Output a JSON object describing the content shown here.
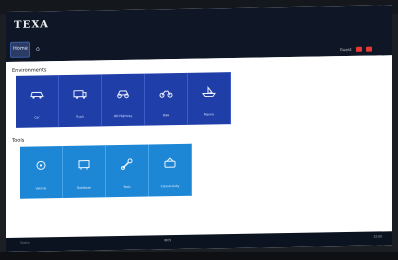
{
  "app": {
    "title": "TEXA",
    "home_tab": "Home"
  },
  "header": {
    "user_label": "Guest"
  },
  "sections": [
    {
      "title": "Environments",
      "tiles": [
        {
          "label": "Car",
          "icon": "car-icon"
        },
        {
          "label": "Truck",
          "icon": "truck-icon"
        },
        {
          "label": "Off-Highway",
          "icon": "off-highway-icon"
        },
        {
          "label": "Bike",
          "icon": "motorcycle-icon"
        },
        {
          "label": "Marine",
          "icon": "boat-icon"
        }
      ]
    },
    {
      "title": "Tools",
      "tiles": [
        {
          "label": "Vehicle",
          "icon": "vehicle-icon"
        },
        {
          "label": "Database",
          "icon": "database-icon"
        },
        {
          "label": "Tools",
          "icon": "wrench-icon"
        },
        {
          "label": "Connectivity",
          "icon": "connectivity-icon"
        }
      ]
    }
  ],
  "status": {
    "left_text": "Status",
    "middle_text": "IDC5",
    "right_text": "12:00"
  }
}
